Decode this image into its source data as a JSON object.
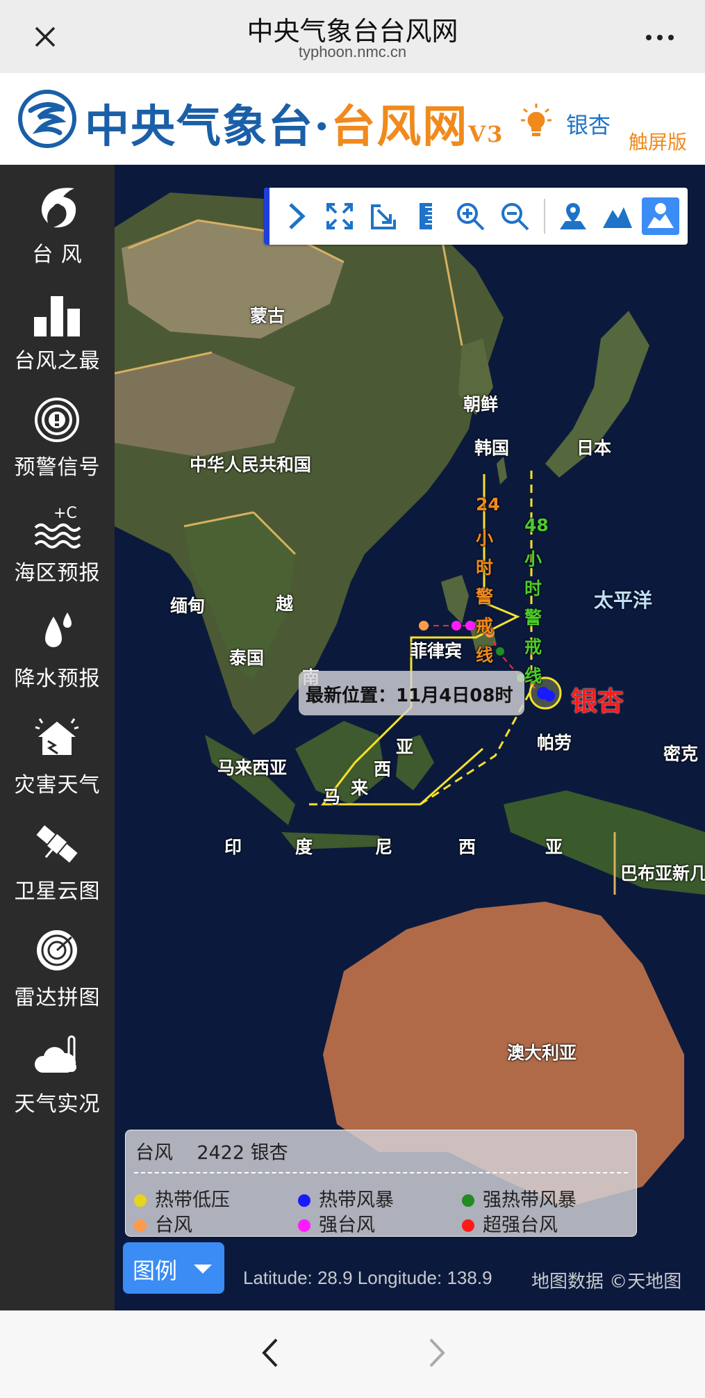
{
  "topbar": {
    "title": "中央气象台台风网",
    "domain": "typhoon.nmc.cn"
  },
  "header": {
    "title_part1": "中央气象台·",
    "title_part2": "台风网",
    "version": "V3",
    "storm_name": "银杏",
    "touch_label": "触屏版"
  },
  "sidebar": {
    "items": [
      {
        "label": "台 风",
        "icon": "typhoon-icon"
      },
      {
        "label": "台风之最",
        "icon": "bar-chart-icon"
      },
      {
        "label": "预警信号",
        "icon": "warning-signal-icon"
      },
      {
        "label": "海区预报",
        "icon": "sea-wave-icon"
      },
      {
        "label": "降水预报",
        "icon": "raindrop-icon"
      },
      {
        "label": "灾害天气",
        "icon": "house-disaster-icon"
      },
      {
        "label": "卫星云图",
        "icon": "satellite-icon"
      },
      {
        "label": "雷达拼图",
        "icon": "radar-icon"
      },
      {
        "label": "天气实况",
        "icon": "cloud-thermometer-icon"
      }
    ]
  },
  "toolbar": {
    "icons": [
      "chevron-right-icon",
      "fullscreen-icon",
      "export-icon",
      "ruler-icon",
      "zoom-in-icon",
      "zoom-out-icon",
      "map-marker-icon",
      "terrain-icon",
      "satellite-layer-icon"
    ]
  },
  "map": {
    "labels": {
      "mongolia": "蒙古",
      "north_korea": "朝鲜",
      "south_korea": "韩国",
      "japan": "日本",
      "china": "中华人民共和国",
      "myanmar": "缅甸",
      "vietnam": "越",
      "thailand": "泰国",
      "nan": "南",
      "philippines": "菲律宾",
      "pacific": "太平洋",
      "palau": "帕劳",
      "micronesia": "密克",
      "malaysia": "马来西亚",
      "ma": "马",
      "lai": "来",
      "xi1": "西",
      "ya1": "亚",
      "yin": "印",
      "du": "度",
      "ni": "尼",
      "xi2": "西",
      "ya2": "亚",
      "png": "巴布亚新几",
      "australia": "澳大利亚"
    },
    "warning_24": {
      "num": "24",
      "chars": [
        "小",
        "时",
        "警",
        "戒",
        "线"
      ]
    },
    "warning_48": {
      "num": "48",
      "chars": [
        "小",
        "时",
        "警",
        "戒",
        "线"
      ]
    },
    "latest_position": "最新位置：11月4日08时",
    "storm_label": "银杏",
    "colors": {
      "line24": "#f7e02a",
      "line48": "#f7e02a",
      "text24": "#f08a1c",
      "text48": "#4ccd2b"
    }
  },
  "legend": {
    "header": "台风    2422 银杏",
    "items": [
      {
        "label": "热带低压",
        "color": "#e6d41e"
      },
      {
        "label": "热带风暴",
        "color": "#1a1aff"
      },
      {
        "label": "强热带风暴",
        "color": "#228b22"
      },
      {
        "label": "台风",
        "color": "#ff9a4a"
      },
      {
        "label": "强台风",
        "color": "#ff1aff"
      },
      {
        "label": "超强台风",
        "color": "#ff1a1a"
      }
    ],
    "button_label": "图例"
  },
  "footer": {
    "coords": "Latitude: 28.9 Longitude: 138.9",
    "attribution": "地图数据 ©天地图"
  }
}
